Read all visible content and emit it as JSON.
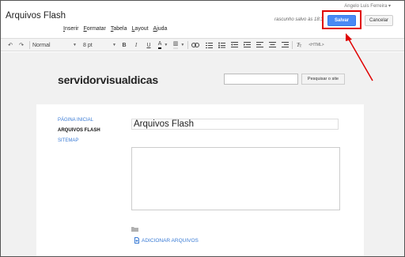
{
  "app": {
    "doc_title": "Arquivos Flash",
    "user_name": "Angelo Luis Ferreira",
    "draft_status": "rascunho salvo às 18:3",
    "save_label": "Salvar",
    "cancel_label": "Cancelar"
  },
  "menu": [
    "Inserir",
    "Formatar",
    "Tabela",
    "Layout",
    "Ajuda"
  ],
  "toolbar": {
    "style_value": "Normal",
    "size_value": "8 pt",
    "html_label": "<HTML>"
  },
  "site": {
    "name": "servidorvisualdicas",
    "search_button": "Pesquisar o site",
    "search_placeholder": ""
  },
  "nav": {
    "items": [
      "PÁGINA INICIAL",
      "ARQUIVOS FLASH",
      "SITEMAP"
    ]
  },
  "page": {
    "title": "Arquivos Flash",
    "add_files_label": "ADICIONAR ARQUIVOS"
  },
  "colors": {
    "accent": "#4a8af4",
    "highlight": "#e00000",
    "link": "#3a7bd5"
  }
}
